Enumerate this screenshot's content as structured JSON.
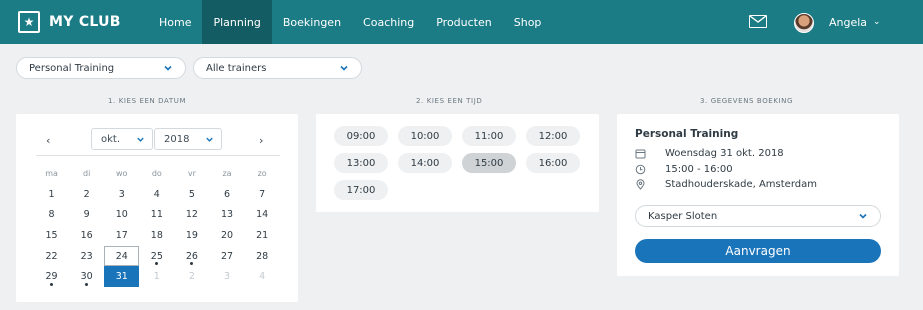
{
  "header": {
    "brand": "MY CLUB",
    "nav": [
      "Home",
      "Planning",
      "Boekingen",
      "Coaching",
      "Producten",
      "Shop"
    ],
    "active_nav": "Planning",
    "user_name": "Angela"
  },
  "filters": {
    "training": "Personal Training",
    "trainers": "Alle trainers"
  },
  "steps": {
    "date": "1. KIES EEN DATUM",
    "time": "2. KIES EEN TIJD",
    "details": "3. GEGEVENS BOEKING"
  },
  "calendar": {
    "month": "okt.",
    "year": "2018",
    "prev": "‹",
    "next": "›",
    "weekdays": [
      "ma",
      "di",
      "wo",
      "do",
      "vr",
      "za",
      "zo"
    ],
    "weeks": [
      [
        {
          "d": "1"
        },
        {
          "d": "2"
        },
        {
          "d": "3"
        },
        {
          "d": "4"
        },
        {
          "d": "5"
        },
        {
          "d": "6"
        },
        {
          "d": "7"
        }
      ],
      [
        {
          "d": "8"
        },
        {
          "d": "9"
        },
        {
          "d": "10"
        },
        {
          "d": "11"
        },
        {
          "d": "12"
        },
        {
          "d": "13"
        },
        {
          "d": "14"
        }
      ],
      [
        {
          "d": "15"
        },
        {
          "d": "16"
        },
        {
          "d": "17"
        },
        {
          "d": "18"
        },
        {
          "d": "19"
        },
        {
          "d": "20"
        },
        {
          "d": "21"
        }
      ],
      [
        {
          "d": "22"
        },
        {
          "d": "23"
        },
        {
          "d": "24",
          "today": true
        },
        {
          "d": "25",
          "dot": true
        },
        {
          "d": "26",
          "dot": true
        },
        {
          "d": "27"
        },
        {
          "d": "28"
        }
      ],
      [
        {
          "d": "29",
          "dot": true
        },
        {
          "d": "30",
          "dot": true
        },
        {
          "d": "31",
          "selected": true
        },
        {
          "d": "1",
          "muted": true
        },
        {
          "d": "2",
          "muted": true
        },
        {
          "d": "3",
          "muted": true
        },
        {
          "d": "4",
          "muted": true
        }
      ]
    ]
  },
  "times": {
    "slots": [
      "09:00",
      "10:00",
      "11:00",
      "12:00",
      "13:00",
      "14:00",
      "15:00",
      "16:00",
      "17:00"
    ],
    "selected": "15:00"
  },
  "booking": {
    "title": "Personal Training",
    "date": "Woensdag 31 okt. 2018",
    "time": "15:00 - 16:00",
    "location": "Stadhouderskade, Amsterdam",
    "coach": "Kasper Sloten",
    "submit_label": "Aanvragen"
  },
  "colors": {
    "topbar": "#1b7c85",
    "topbar_active": "#145c63",
    "primary_button": "#1a74ba"
  }
}
